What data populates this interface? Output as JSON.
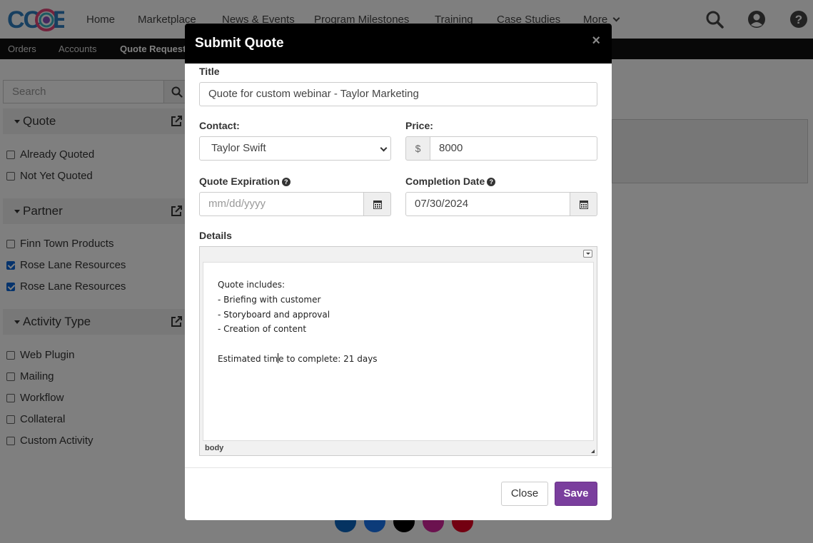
{
  "app": {
    "brand_colors": {
      "accent": "#7a3e9d",
      "header_bg": "#000000",
      "subnav_bg": "#111111"
    }
  },
  "header": {
    "nav": [
      "Home",
      "Marketplace",
      "News & Events",
      "Program Milestones",
      "Training",
      "Case Studies",
      "More"
    ],
    "icons": [
      "search-icon",
      "user-icon",
      "help-icon"
    ]
  },
  "subnav": {
    "items": [
      "Orders",
      "Accounts",
      "Quote Requests"
    ],
    "active": "Quote Requests"
  },
  "sidebar": {
    "search_placeholder": "Search",
    "facets": [
      {
        "title": "Quote",
        "options": [
          {
            "label": "Already Quoted",
            "checked": false
          },
          {
            "label": "Not Yet Quoted",
            "checked": false
          }
        ]
      },
      {
        "title": "Partner",
        "options": [
          {
            "label": "Finn Town Products",
            "checked": false
          },
          {
            "label": "Rose Lane Resources",
            "checked": true
          },
          {
            "label": "Rose Lane Resources",
            "checked": true
          }
        ]
      },
      {
        "title": "Activity Type",
        "options": [
          {
            "label": "Web Plugin",
            "checked": false
          },
          {
            "label": "Mailing",
            "checked": false
          },
          {
            "label": "Workflow",
            "checked": false
          },
          {
            "label": "Collateral",
            "checked": false
          },
          {
            "label": "Custom Activity",
            "checked": false
          }
        ]
      }
    ]
  },
  "social_icons": [
    "linkedin-icon",
    "facebook-icon",
    "x-icon",
    "instagram-icon",
    "pinterest-icon"
  ],
  "modal": {
    "title": "Submit Quote",
    "close_glyph": "×",
    "fields": {
      "title_label": "Title",
      "title_value": "Quote for custom webinar - Taylor Marketing",
      "contact_label": "Contact:",
      "contact_value": "Taylor Swift",
      "price_label": "Price:",
      "price_prefix": "$",
      "price_value": "8000",
      "expiration_label": "Quote Expiration",
      "expiration_placeholder": "mm/dd/yyyy",
      "completion_label": "Completion Date",
      "completion_value": "07/30/2024",
      "details_label": "Details"
    },
    "details_lines": [
      "Quote includes:",
      "- Briefing with customer",
      "- Storyboard and approval",
      "- Creation of content",
      "",
      "Estimated time to complete: 21 days"
    ],
    "details_caret_before": "Estimated tim",
    "details_caret_after": "e to complete: 21 days",
    "editor_path": "body",
    "buttons": {
      "close": "Close",
      "save": "Save"
    }
  }
}
